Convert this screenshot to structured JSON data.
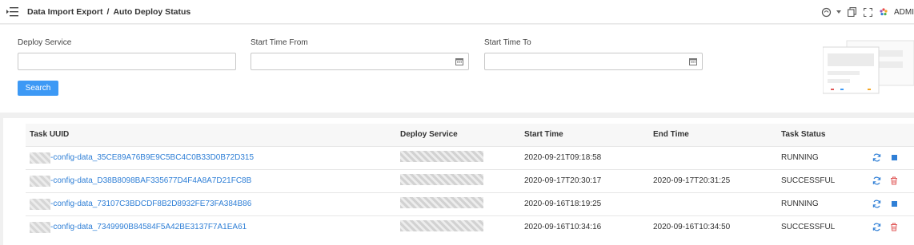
{
  "header": {
    "menu_icon": "hamburger-menu-icon",
    "breadcrumb": [
      "Data Import Export",
      "Auto Deploy Status"
    ],
    "separator": "/",
    "user_label": "ADMI"
  },
  "filters": {
    "deploy_service": {
      "label": "Deploy Service",
      "value": ""
    },
    "start_time_from": {
      "label": "Start Time From",
      "value": ""
    },
    "start_time_to": {
      "label": "Start Time To",
      "value": ""
    },
    "search_label": "Search"
  },
  "table": {
    "columns": [
      "Task UUID",
      "Deploy Service",
      "Start Time",
      "End Time",
      "Task Status"
    ],
    "rows": [
      {
        "uuid": "-config-data_35CE89A76B9E9C5BC4C0B33D0B72D315",
        "deploy_service": "",
        "start_time": "2020-09-21T09:18:58",
        "end_time": "",
        "status": "RUNNING",
        "secondary_action": "stop-icon"
      },
      {
        "uuid": "-config-data_D38B8098BAF335677D4F4A8A7D21FC8B",
        "deploy_service": "",
        "start_time": "2020-09-17T20:30:17",
        "end_time": "2020-09-17T20:31:25",
        "status": "SUCCESSFUL",
        "secondary_action": "delete-icon"
      },
      {
        "uuid": "-config-data_73107C3BDCDF8B2D8932FE73FA384B86",
        "deploy_service": "",
        "start_time": "2020-09-16T18:19:25",
        "end_time": "",
        "status": "RUNNING",
        "secondary_action": "stop-icon"
      },
      {
        "uuid": "-config-data_7349990B84584F5A42BE3137F7A1EA61",
        "deploy_service": "",
        "start_time": "2020-09-16T10:34:16",
        "end_time": "2020-09-16T10:34:50",
        "status": "SUCCESSFUL",
        "secondary_action": "delete-icon"
      }
    ]
  },
  "colors": {
    "accent": "#3d99f5",
    "link": "#2f7fd6",
    "delete": "#e05a5a"
  }
}
